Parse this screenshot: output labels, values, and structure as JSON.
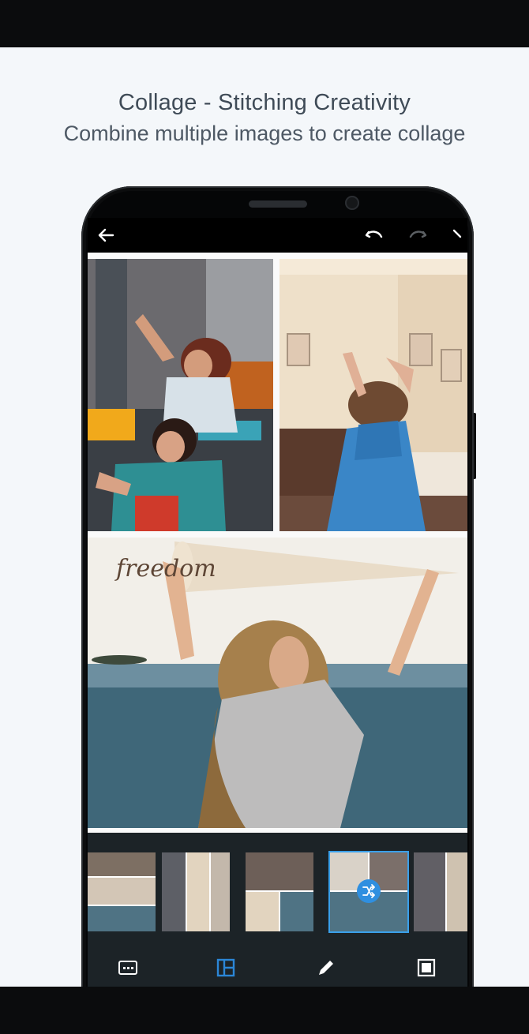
{
  "header": {
    "title": "Collage - Stitching Creativity",
    "subtitle": "Combine multiple images to create collage"
  },
  "app": {
    "icons": {
      "back": "arrow-left-icon",
      "undo": "undo-icon",
      "redo": "redo-icon"
    },
    "collage": {
      "banner_text": "freedom",
      "photos": [
        "two-friends-photo",
        "dancing-woman-photo",
        "freedom-sea-photo"
      ]
    },
    "thumbnails": [
      {
        "name": "layout-thumb-1",
        "selected": false
      },
      {
        "name": "layout-thumb-2",
        "selected": false
      },
      {
        "name": "layout-thumb-3",
        "selected": false
      },
      {
        "name": "layout-thumb-4",
        "selected": true
      },
      {
        "name": "layout-thumb-5",
        "selected": false
      }
    ],
    "tools": [
      {
        "name": "aspect-ratio-icon",
        "active": false
      },
      {
        "name": "layout-icon",
        "active": true
      },
      {
        "name": "pencil-icon",
        "active": false
      },
      {
        "name": "border-icon",
        "active": false
      }
    ],
    "colors": {
      "accent": "#2b86d6",
      "toolbar": "#1c2327",
      "selected_shuffle": "#2f8fe0"
    }
  }
}
